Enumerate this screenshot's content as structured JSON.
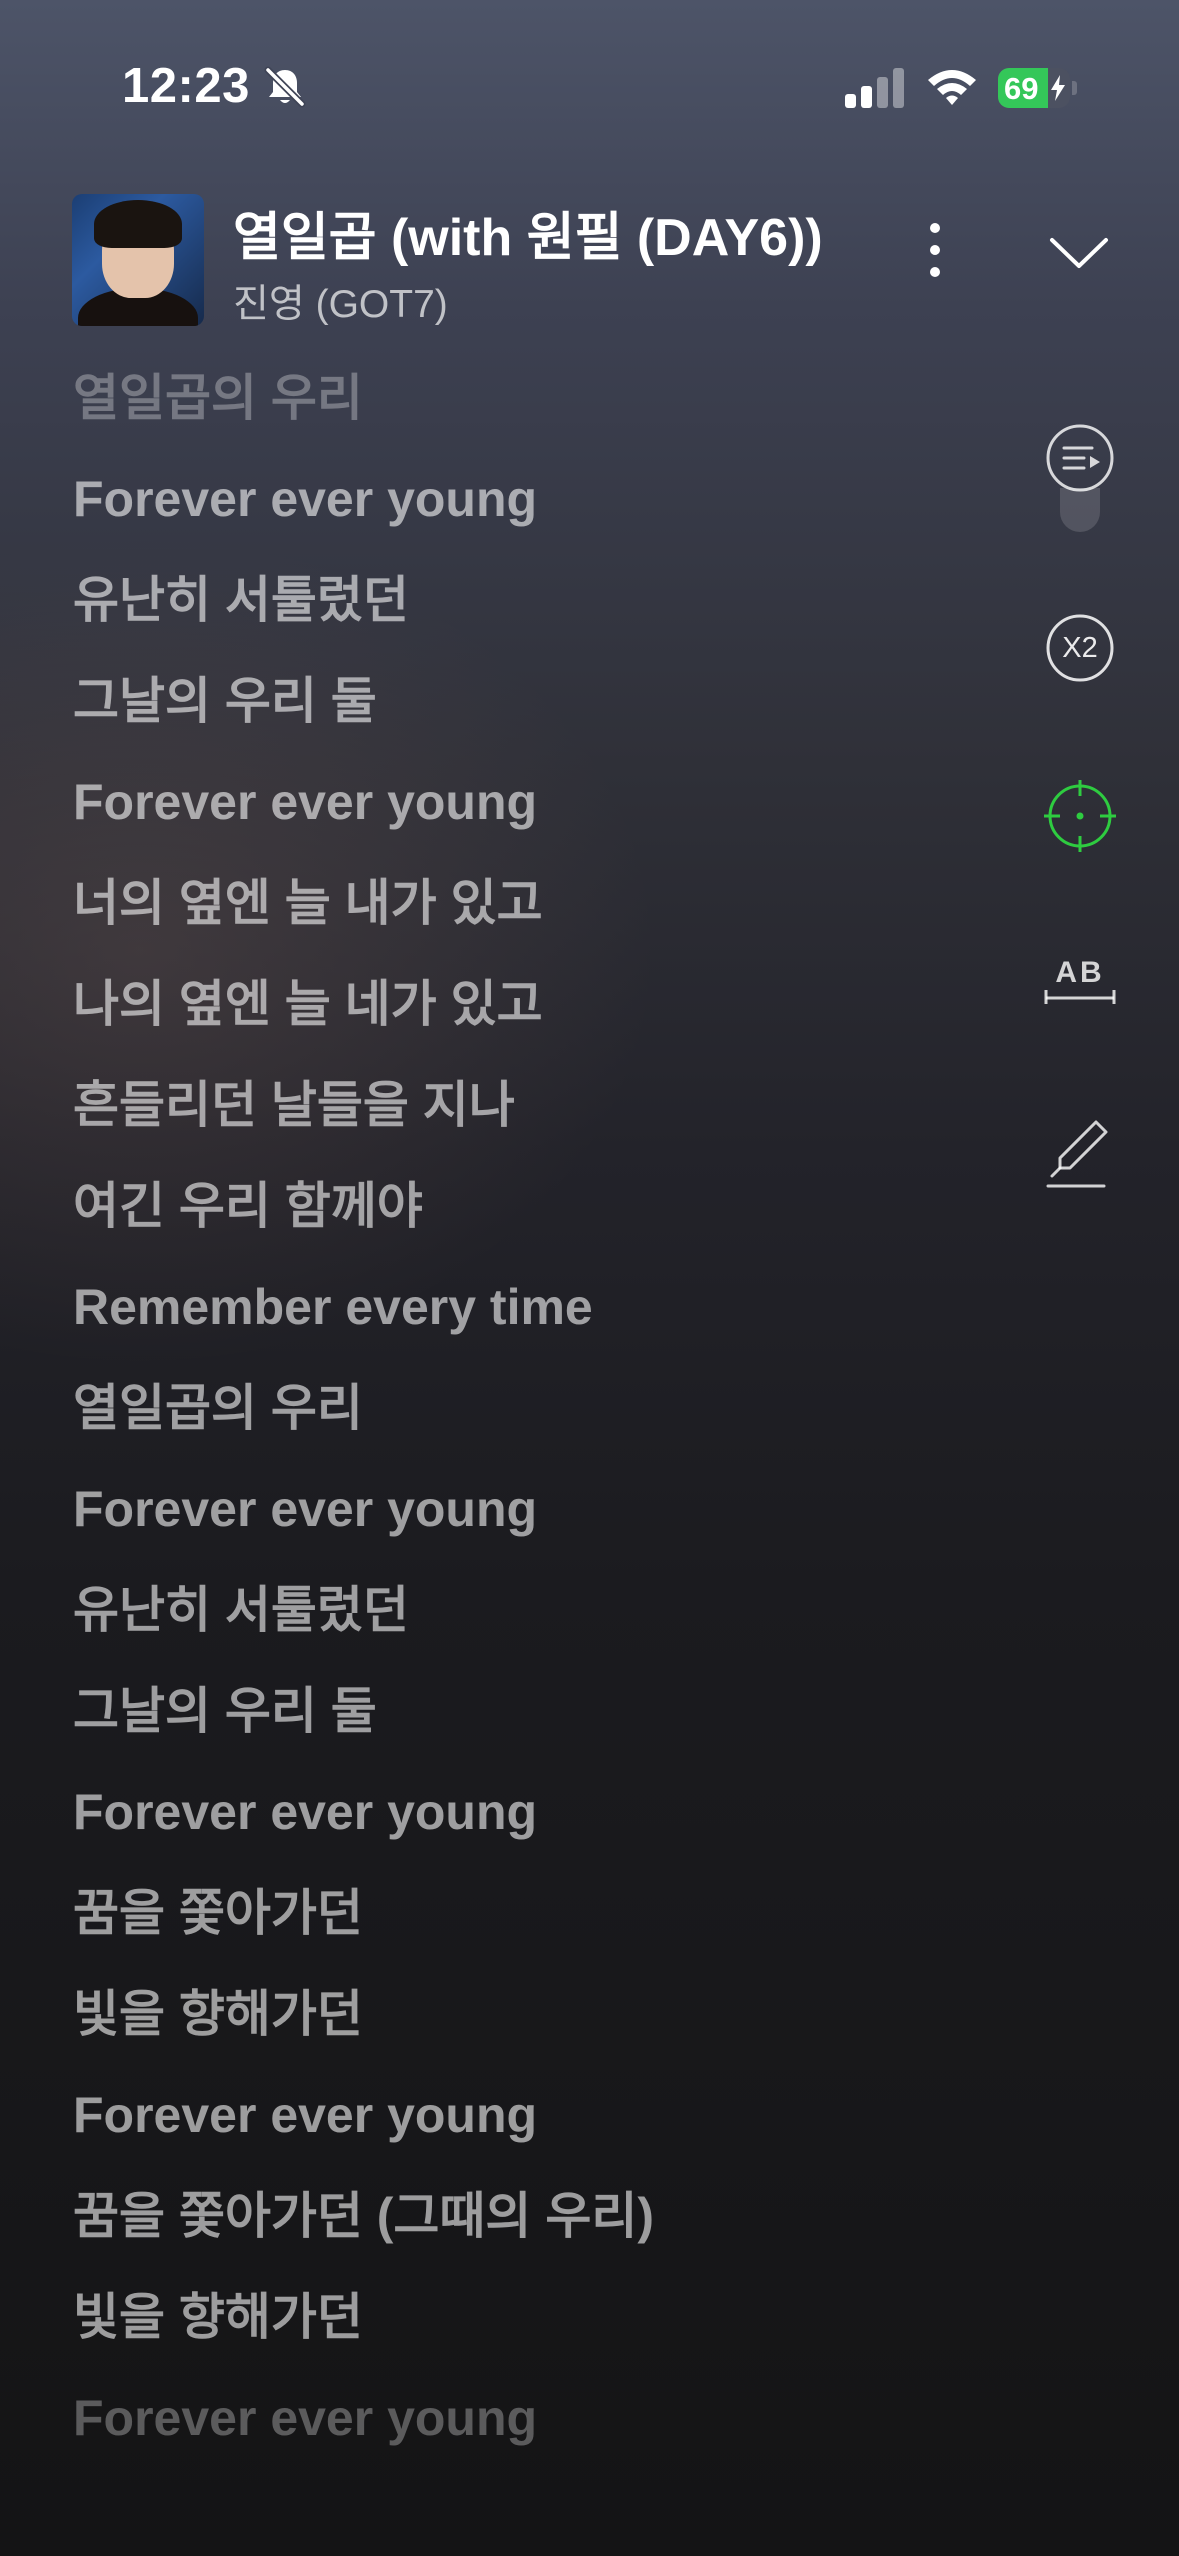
{
  "status_bar": {
    "time": "12:23",
    "battery_level": "69",
    "battery_fraction": 0.69,
    "icons": [
      "bell-off-icon",
      "signal-icon",
      "wifi-icon",
      "battery-icon"
    ]
  },
  "now_playing": {
    "title": "열일곱 (with 원필 (DAY6))",
    "artist": "진영 (GOT7)",
    "icons": [
      "more-vertical-icon",
      "chevron-down-icon"
    ]
  },
  "lyrics": [
    "열일곱의 우리",
    "Forever ever young",
    "유난히 서툴렀던",
    "그날의 우리 둘",
    "Forever ever young",
    "너의 옆엔 늘 내가 있고",
    "나의 옆엔 늘 네가 있고",
    "흔들리던 날들을 지나",
    "여긴 우리 함께야",
    "Remember every time",
    "열일곱의 우리",
    "Forever ever young",
    "유난히 서툴렀던",
    "그날의 우리 둘",
    "Forever ever young",
    "꿈을 쫓아가던",
    "빛을 향해가던",
    "Forever ever young",
    "꿈을 쫓아가던 (그때의 우리)",
    "빛을 향해가던",
    "Forever ever young"
  ],
  "side_tools": [
    {
      "name": "playlist-icon",
      "label": ""
    },
    {
      "name": "font-size-icon",
      "label": "X2"
    },
    {
      "name": "sync-target-icon",
      "label": ""
    },
    {
      "name": "translate-icon",
      "label": "AB"
    },
    {
      "name": "highlight-pen-icon",
      "label": ""
    }
  ],
  "colors": {
    "accent_green": "#34c759",
    "target_green": "#2ecc40"
  }
}
